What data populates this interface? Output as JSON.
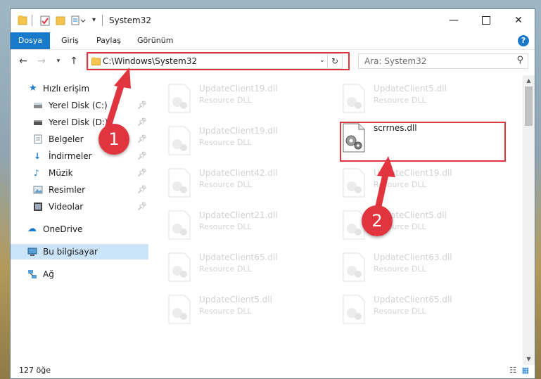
{
  "window": {
    "title": "System32",
    "minimize_icon": "minimize-icon",
    "maximize_icon": "maximize-icon",
    "close_icon": "close-icon"
  },
  "ribbon": {
    "tabs": [
      "Dosya",
      "Giriş",
      "Paylaş",
      "Görünüm"
    ],
    "help": "?"
  },
  "address": {
    "path": "C:\\Windows\\System32",
    "search_placeholder": "Ara: System32"
  },
  "nav": {
    "quick_access": "Hızlı erişim",
    "items": [
      {
        "label": "Yerel Disk (C:)",
        "icon": "drive-icon",
        "pinned": true
      },
      {
        "label": "Yerel Disk (D:)",
        "icon": "drive-icon",
        "pinned": true
      },
      {
        "label": "Belgeler",
        "icon": "documents-icon",
        "pinned": true
      },
      {
        "label": "İndirmeler",
        "icon": "download-icon",
        "pinned": true
      },
      {
        "label": "Müzik",
        "icon": "music-icon",
        "pinned": true
      },
      {
        "label": "Resimler",
        "icon": "pictures-icon",
        "pinned": true
      },
      {
        "label": "Videolar",
        "icon": "videos-icon",
        "pinned": true
      }
    ],
    "onedrive": "OneDrive",
    "this_pc": "Bu bilgisayar",
    "network": "Ağ"
  },
  "files": {
    "left_column": [
      {
        "name": "UpdateClient19.dll",
        "type": "Resource DLL"
      },
      {
        "name": "UpdateClient19.dll",
        "type": "Resource DLL"
      },
      {
        "name": "UpdateClient42.dll",
        "type": "Resource DLL"
      },
      {
        "name": "UpdateClient21.dll",
        "type": "Resource DLL"
      },
      {
        "name": "UpdateClient65.dll",
        "type": "Resource DLL"
      },
      {
        "name": "UpdateClient5.dll",
        "type": "Resource DLL"
      }
    ],
    "right_column": [
      {
        "name": "UpdateClient5.dll",
        "type": "Resource DLL"
      },
      {
        "name": "scrrnes.dll",
        "type": ""
      },
      {
        "name": "UpdateClient19.dll",
        "type": "Resource DLL"
      },
      {
        "name": "UpdateClient5.dll",
        "type": "Resource DLL"
      },
      {
        "name": "UpdateClient63.dll",
        "type": "Resource DLL"
      },
      {
        "name": "UpdateClient65.dll",
        "type": "Resource DLL"
      }
    ]
  },
  "status": {
    "count": "127 öğe"
  },
  "annotations": {
    "step1": "1",
    "step2": "2",
    "color": "#e0353f"
  }
}
